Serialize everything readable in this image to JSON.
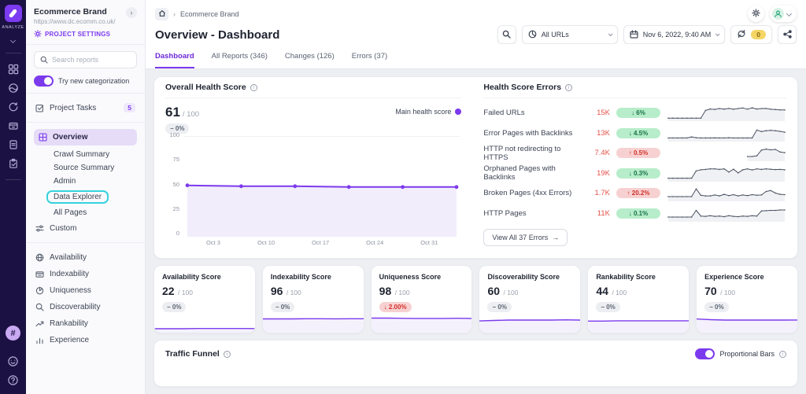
{
  "accent": "#7c3aed",
  "rail": {
    "brand": "ANALYZE"
  },
  "sidebar": {
    "project_name": "Ecommerce Brand",
    "project_url": "https://www.dc.ecomm.co.uk/",
    "settings_label": "PROJECT SETTINGS",
    "search_placeholder": "Search reports",
    "categorization_label": "Try new categorization",
    "tasks_label": "Project Tasks",
    "tasks_count": "5",
    "overview_label": "Overview",
    "overview_children": [
      {
        "label": "Crawl Summary"
      },
      {
        "label": "Source Summary"
      },
      {
        "label": "Admin"
      },
      {
        "label": "Data Explorer"
      },
      {
        "label": "All Pages"
      }
    ],
    "custom_label": "Custom",
    "groups": [
      {
        "label": "Availability"
      },
      {
        "label": "Indexability"
      },
      {
        "label": "Uniqueness"
      },
      {
        "label": "Discoverability"
      },
      {
        "label": "Rankability"
      },
      {
        "label": "Experience"
      }
    ]
  },
  "header": {
    "breadcrumb": "Ecommerce Brand",
    "title": "Overview - Dashboard",
    "url_filter_label": "All URLs",
    "date_label": "Nov 6, 2022, 9:40 AM",
    "compare_count": "0"
  },
  "tabs": [
    {
      "label": "Dashboard"
    },
    {
      "label": "All Reports (346)"
    },
    {
      "label": "Changes (126)"
    },
    {
      "label": "Errors (37)"
    }
  ],
  "health": {
    "title": "Overall Health Score",
    "score": "61",
    "score_max": "/ 100",
    "delta": "− 0%",
    "delta_type": "flat",
    "legend": "Main health score",
    "yticks": [
      "100",
      "75",
      "50",
      "25",
      "0"
    ],
    "xticks": [
      "Oct 3",
      "Oct 10",
      "Oct 17",
      "Oct 24",
      "Oct 31"
    ],
    "chart": {
      "type": "line",
      "min": 0,
      "max": 100,
      "values": [
        63,
        62,
        62,
        61,
        61,
        61
      ],
      "stroke": "#7c3aed",
      "strokeW": 2,
      "fill": "#f1edfb",
      "dotR": 2.4,
      "padX": 4,
      "padT": 24,
      "padB": 1
    }
  },
  "errors": {
    "title": "Health Score Errors",
    "view_all_label": "View All 37 Errors",
    "arrow": "→",
    "rows": [
      {
        "label": "Failed URLs",
        "value": "15K",
        "delta": "↓ 6%",
        "type": "good",
        "spark": {
          "type": "line",
          "min": 0,
          "max": 9.5,
          "values": [
            1,
            1,
            1,
            1,
            1,
            1,
            1,
            1,
            6.5,
            7.5,
            7.2,
            7.8,
            7.4,
            7.9,
            7.3,
            7.8,
            8.2,
            7.4,
            8.3,
            7.5,
            7.8,
            7.9,
            7.3,
            7.1,
            6.9,
            6.8
          ],
          "stroke": "#4b5363",
          "strokeW": 1,
          "fill": "#f0f1f4",
          "dotR": 0.8
        }
      },
      {
        "label": "Error Pages with Backlinks",
        "value": "13K",
        "delta": "↓ 4.5%",
        "type": "good",
        "spark": {
          "type": "line",
          "min": 0,
          "max": 6.5,
          "values": [
            1,
            1,
            1,
            1,
            1,
            1.5,
            1.1,
            1,
            1,
            1,
            1.05,
            1,
            1,
            1.1,
            1,
            1,
            1,
            1,
            1,
            4.8,
            4.1,
            4.5,
            4.7,
            4.5,
            4.2,
            3.8
          ],
          "stroke": "#4b5363",
          "strokeW": 1,
          "fill": "#f0f1f4",
          "dotR": 0.8
        }
      },
      {
        "label": "HTTP not redirecting to HTTPS",
        "value": "7.4K",
        "delta": "↑ 0.5%",
        "type": "bad",
        "spark": {
          "type": "line",
          "min": 0,
          "max": 4.2,
          "values": [
            null,
            null,
            null,
            null,
            null,
            null,
            null,
            null,
            null,
            null,
            null,
            null,
            null,
            null,
            null,
            null,
            null,
            1,
            1,
            1.2,
            3,
            3.3,
            3.1,
            3.2,
            2.4,
            2.2
          ],
          "stroke": "#4b5363",
          "strokeW": 1,
          "fill": "#f0f1f4",
          "dotR": 0.8
        }
      },
      {
        "label": "Orphaned Pages with Backlinks",
        "value": "19K",
        "delta": "↓ 0.3%",
        "type": "good",
        "spark": {
          "type": "line",
          "min": 0,
          "max": 7,
          "values": [
            1,
            1,
            1,
            1,
            1,
            1,
            4.8,
            5.4,
            5.6,
            5.9,
            5.9,
            5.6,
            5.9,
            4.2,
            5.7,
            3.8,
            5.4,
            5.9,
            5.3,
            5.9,
            5.6,
            5.9,
            5.7,
            5.5,
            5.6,
            5.4
          ],
          "stroke": "#4b5363",
          "strokeW": 1,
          "fill": "#f0f1f4",
          "dotR": 0.8
        }
      },
      {
        "label": "Broken Pages (4xx Errors)",
        "value": "1.7K",
        "delta": "↑ 20.2%",
        "type": "bad",
        "spark": {
          "type": "line",
          "min": 0,
          "max": 4.2,
          "values": [
            1,
            1,
            1,
            1,
            1,
            1,
            3.4,
            1.4,
            1.2,
            1.2,
            1.5,
            1.2,
            1.7,
            1.3,
            1.6,
            1.2,
            1.5,
            1.3,
            1.6,
            1.4,
            1.5,
            2.6,
            2.9,
            2.1,
            1.7,
            1.6
          ],
          "stroke": "#4b5363",
          "strokeW": 1,
          "fill": "#f0f1f4",
          "dotR": 0.8
        }
      },
      {
        "label": "HTTP Pages",
        "value": "11K",
        "delta": "↓ 0.1%",
        "type": "good",
        "spark": {
          "type": "line",
          "min": 0,
          "max": 4.2,
          "values": [
            1,
            1,
            1,
            1,
            1,
            1,
            3.1,
            1.3,
            1.2,
            1.4,
            1.2,
            1.3,
            1.1,
            1.4,
            1.2,
            1.1,
            1.3,
            1.2,
            1.4,
            1.3,
            2.9,
            3,
            3.1,
            3.1,
            3.2,
            3.2
          ],
          "stroke": "#4b5363",
          "strokeW": 1,
          "fill": "#f0f1f4",
          "dotR": 0.8
        }
      }
    ]
  },
  "scores": [
    {
      "title": "Availability Score",
      "score": "22",
      "max": "/ 100",
      "delta": "− 0%",
      "type": "flat",
      "spark": {
        "type": "line",
        "min": 0,
        "max": 100,
        "values": [
          21,
          21,
          21,
          22,
          22,
          22,
          22,
          21.5
        ],
        "stroke": "#7c3aed",
        "strokeW": 1.4,
        "fill": "#f4f1fc",
        "padX": 0,
        "padB": 0,
        "padT": 2
      }
    },
    {
      "title": "Indexability Score",
      "score": "96",
      "max": "/ 100",
      "delta": "− 0%",
      "type": "flat",
      "spark": {
        "type": "line",
        "min": 0,
        "max": 130,
        "values": [
          95,
          95,
          95,
          96,
          96,
          95.5,
          96,
          96
        ],
        "stroke": "#7c3aed",
        "strokeW": 1.4,
        "fill": "#f4f1fc",
        "padX": 0,
        "padB": 0,
        "padT": 2
      }
    },
    {
      "title": "Uniqueness Score",
      "score": "98",
      "max": "/ 100",
      "delta": "↓ 2.00%",
      "type": "bad",
      "spark": {
        "type": "line",
        "min": 0,
        "max": 130,
        "values": [
          100,
          100,
          99,
          98,
          98,
          98,
          99,
          98
        ],
        "stroke": "#7c3aed",
        "strokeW": 1.4,
        "fill": "#f4f1fc",
        "padX": 0,
        "padB": 0,
        "padT": 2
      }
    },
    {
      "title": "Discoverability Score",
      "score": "60",
      "max": "/ 100",
      "delta": "− 0%",
      "type": "flat",
      "spark": {
        "type": "line",
        "min": 0,
        "max": 90,
        "values": [
          56,
          58,
          60,
          60,
          60,
          60,
          61,
          60
        ],
        "stroke": "#7c3aed",
        "strokeW": 1.4,
        "fill": "#f4f1fc",
        "padX": 0,
        "padB": 0,
        "padT": 2
      }
    },
    {
      "title": "Rankability Score",
      "score": "44",
      "max": "/ 100",
      "delta": "− 0%",
      "type": "flat",
      "spark": {
        "type": "line",
        "min": 0,
        "max": 70,
        "values": [
          43,
          43,
          44,
          44,
          44,
          44,
          44,
          44
        ],
        "stroke": "#7c3aed",
        "strokeW": 1.4,
        "fill": "#f4f1fc",
        "padX": 0,
        "padB": 0,
        "padT": 2
      }
    },
    {
      "title": "Experience Score",
      "score": "70",
      "max": "/ 100",
      "delta": "− 0%",
      "type": "flat",
      "spark": {
        "type": "line",
        "min": 0,
        "max": 105,
        "values": [
          76,
          72,
          70,
          70,
          70,
          70,
          70,
          70.5
        ],
        "stroke": "#7c3aed",
        "strokeW": 1.4,
        "fill": "#f4f1fc",
        "padX": 0,
        "padB": 0,
        "padT": 2
      }
    }
  ],
  "funnel": {
    "title": "Traffic Funnel",
    "toggle_label": "Proportional Bars"
  }
}
